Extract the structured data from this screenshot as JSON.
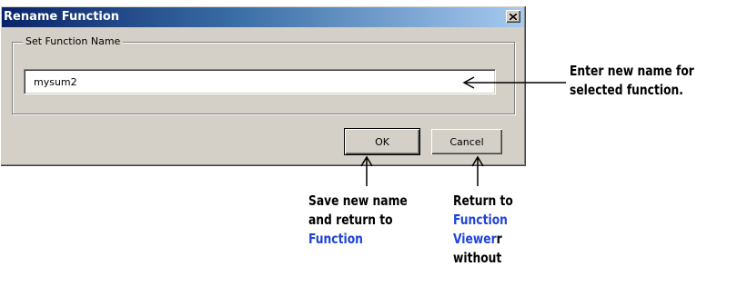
{
  "dialog": {
    "title": "Rename Function",
    "close_glyph": "✕",
    "group_label": "Set Function Name",
    "input_value": "mysum2",
    "ok_label": "OK",
    "cancel_label": "Cancel"
  },
  "annotations": {
    "enter": {
      "line1": "Enter new name for",
      "line2": "selected function."
    },
    "save": {
      "line1": "Save new name",
      "line2": "and return to",
      "line3": "Function"
    },
    "return": {
      "line1": "Return to",
      "line2": "Function",
      "line3_link": "Viewer",
      "line3_rest": "r",
      "line4": "without"
    }
  },
  "colors": {
    "link": "#1f44d6",
    "title_start": "#0a246a",
    "title_end": "#a6caf0",
    "face": "#d4d0c8"
  }
}
